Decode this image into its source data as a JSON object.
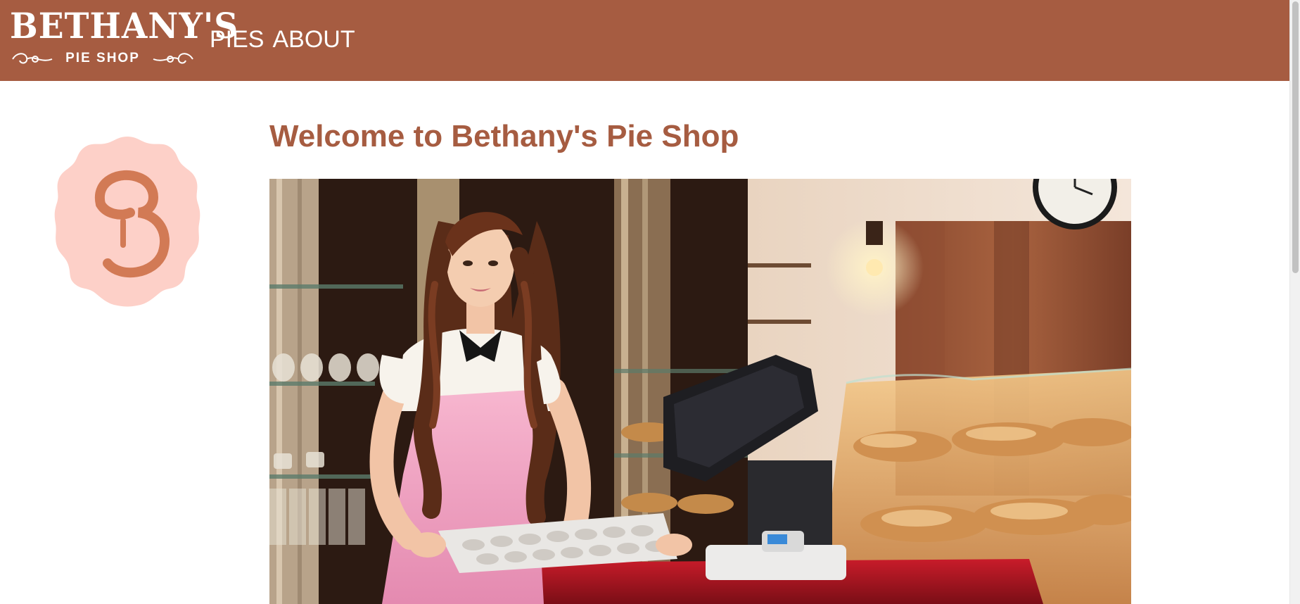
{
  "header": {
    "logo": {
      "title": "BETHANY'S",
      "subtitle": "PIE SHOP"
    },
    "nav": [
      {
        "label": "PIES"
      },
      {
        "label": "ABOUT"
      }
    ],
    "background_color": "#a65c41"
  },
  "sidebar": {
    "badge_letter": "B",
    "badge_color": "#fdd0c8",
    "badge_glyph_color": "#d27a55"
  },
  "main": {
    "heading": "Welcome to Bethany's Pie Shop",
    "heading_color": "#a65c41",
    "hero_image": {
      "icon": "shop-photo"
    }
  }
}
